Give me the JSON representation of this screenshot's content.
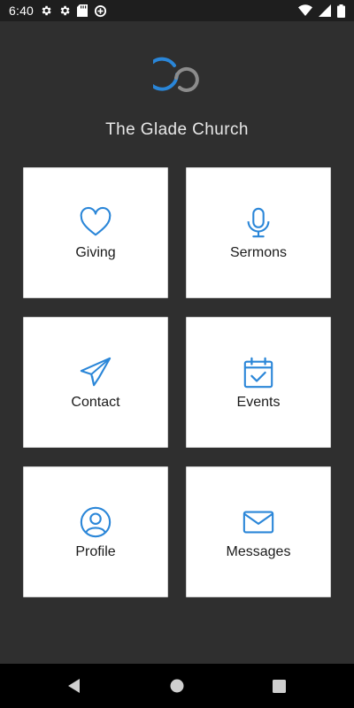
{
  "status_bar": {
    "time": "6:40",
    "left_icons": [
      "gear-icon",
      "gear-icon",
      "sd-card-icon",
      "data-saver-icon"
    ],
    "right_icons": [
      "wifi-icon",
      "cellular-icon",
      "battery-icon"
    ]
  },
  "header": {
    "title": "The Glade Church"
  },
  "tiles": [
    {
      "label": "Giving",
      "icon": "heart-icon"
    },
    {
      "label": "Sermons",
      "icon": "microphone-icon"
    },
    {
      "label": "Contact",
      "icon": "paper-plane-icon"
    },
    {
      "label": "Events",
      "icon": "calendar-check-icon"
    },
    {
      "label": "Profile",
      "icon": "user-circle-icon"
    },
    {
      "label": "Messages",
      "icon": "envelope-icon"
    }
  ],
  "colors": {
    "background": "#2f2f2f",
    "accent_blue": "#2a86d8",
    "logo_gray": "#8c8c8c",
    "tile_bg": "#ffffff"
  },
  "nav_bar": {
    "buttons": [
      "back-icon",
      "home-icon",
      "recents-icon"
    ]
  }
}
